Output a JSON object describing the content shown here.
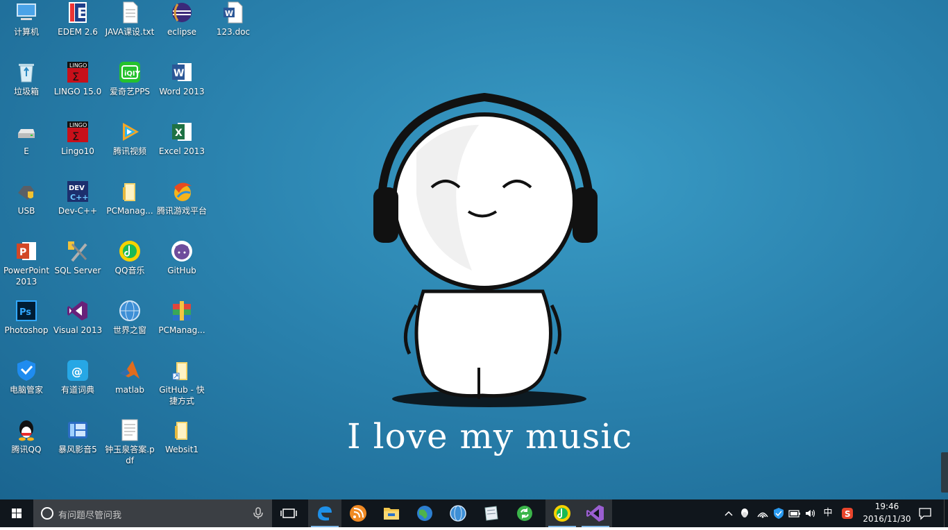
{
  "desktop": {
    "icons": [
      {
        "label": "计算机",
        "icon": "computer-icon"
      },
      {
        "label": "EDEM 2.6",
        "icon": "edem-icon"
      },
      {
        "label": "JAVA课设.txt",
        "icon": "text-file-icon"
      },
      {
        "label": "eclipse",
        "icon": "eclipse-icon"
      },
      {
        "label": "123.doc",
        "icon": "word-doc-icon"
      },
      {
        "label": "垃圾箱",
        "icon": "recycle-bin-icon"
      },
      {
        "label": "LINGO 15.0",
        "icon": "lingo-icon"
      },
      {
        "label": "爱奇艺PPS",
        "icon": "iqiyi-icon"
      },
      {
        "label": "Word 2013",
        "icon": "word-icon"
      },
      {
        "label": "E",
        "icon": "drive-icon"
      },
      {
        "label": "Lingo10",
        "icon": "lingo-icon"
      },
      {
        "label": "腾讯视频",
        "icon": "tencent-video-icon"
      },
      {
        "label": "Excel 2013",
        "icon": "excel-icon"
      },
      {
        "label": "USB",
        "icon": "usb-drive-icon"
      },
      {
        "label": "Dev-C++",
        "icon": "devcpp-icon"
      },
      {
        "label": "PCManag...",
        "icon": "folder-icon"
      },
      {
        "label": "腾讯游戏平台",
        "icon": "tencent-games-icon"
      },
      {
        "label": "PowerPoint 2013",
        "icon": "powerpoint-icon"
      },
      {
        "label": "SQL Server",
        "icon": "sql-server-icon"
      },
      {
        "label": "QQ音乐",
        "icon": "qq-music-icon"
      },
      {
        "label": "GitHub",
        "icon": "github-icon"
      },
      {
        "label": "Photoshop",
        "icon": "photoshop-icon"
      },
      {
        "label": "Visual 2013",
        "icon": "visual-studio-icon"
      },
      {
        "label": "世界之窗",
        "icon": "globe-browser-icon"
      },
      {
        "label": "PCManag...",
        "icon": "archive-icon"
      },
      {
        "label": "电脑管家",
        "icon": "pc-manager-icon"
      },
      {
        "label": "有道词典",
        "icon": "youdao-icon"
      },
      {
        "label": "matlab",
        "icon": "matlab-icon"
      },
      {
        "label": "GitHub - 快捷方式",
        "icon": "folder-shortcut-icon"
      },
      {
        "label": "腾讯QQ",
        "icon": "qq-icon"
      },
      {
        "label": "暴风影音5",
        "icon": "baofeng-icon"
      },
      {
        "label": "钟玉泉答案.pdf",
        "icon": "pdf-file-icon"
      },
      {
        "label": "Websit1",
        "icon": "folder-icon"
      }
    ],
    "wallpaper_text": "I love my music"
  },
  "taskbar": {
    "search_placeholder": "有问题尽管问我",
    "pinned": [
      {
        "name": "edge-icon",
        "active": true
      },
      {
        "name": "rss-reader-icon",
        "active": false
      },
      {
        "name": "file-explorer-icon",
        "active": false
      },
      {
        "name": "globe-browser-icon",
        "active": false
      },
      {
        "name": "world-browser-icon",
        "active": false
      },
      {
        "name": "notepad-icon",
        "active": false
      },
      {
        "name": "sync-icon",
        "active": false
      },
      {
        "name": "qq-music-icon",
        "active": true
      },
      {
        "name": "visual-studio-icon",
        "active": true
      }
    ],
    "tray": {
      "ime_label": "中",
      "time": "19:46",
      "date": "2016/11/30"
    }
  },
  "colors": {
    "taskbar": "#10161c",
    "search_box": "#3b3f44",
    "accent": "#7fb7e6"
  }
}
